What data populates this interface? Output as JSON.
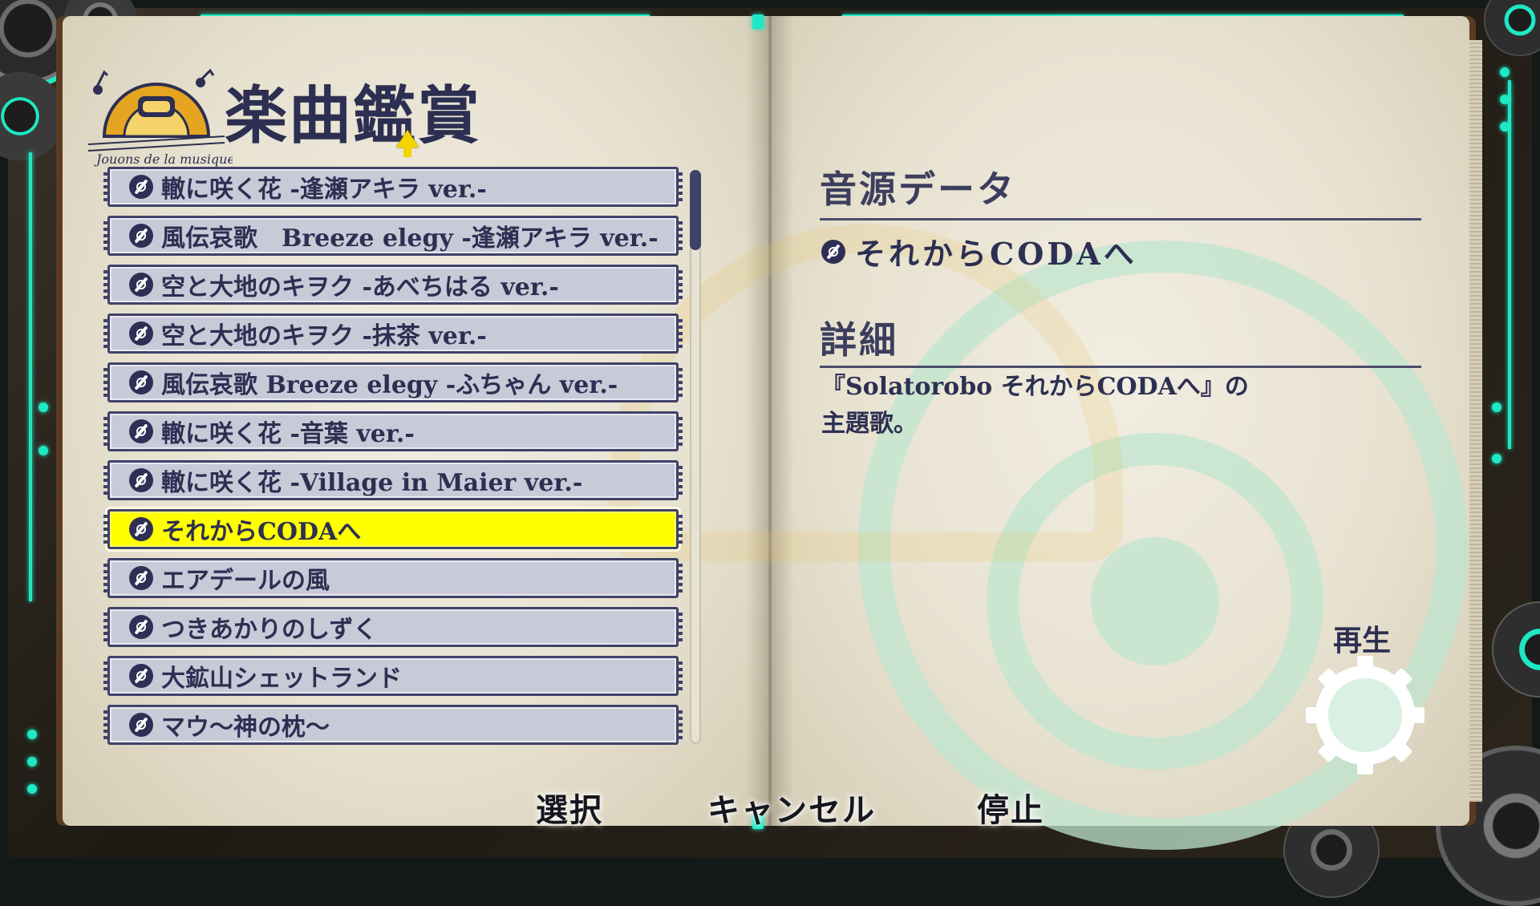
{
  "header": {
    "title": "楽曲鑑賞",
    "logo_text": "Jouons de la musique!"
  },
  "song_list": {
    "items": [
      {
        "label": "轍に咲く花 -逢瀬アキラ ver.-",
        "selected": false
      },
      {
        "label": "風伝哀歌　Breeze elegy -逢瀬アキラ ver.-",
        "selected": false
      },
      {
        "label": "空と大地のキヲク -あべちはる ver.-",
        "selected": false
      },
      {
        "label": "空と大地のキヲク -抹茶 ver.-",
        "selected": false
      },
      {
        "label": "風伝哀歌 Breeze elegy -ふちゃん ver.-",
        "selected": false
      },
      {
        "label": "轍に咲く花 -音葉 ver.-",
        "selected": false
      },
      {
        "label": "轍に咲く花 -Village in Maier ver.-",
        "selected": false
      },
      {
        "label": "それからCODAへ",
        "selected": true
      },
      {
        "label": "エアデールの風",
        "selected": false
      },
      {
        "label": "つきあかりのしずく",
        "selected": false
      },
      {
        "label": "大鉱山シェットランド",
        "selected": false
      },
      {
        "label": "マウ〜神の枕〜",
        "selected": false
      }
    ],
    "item_icon": "music-disc-icon"
  },
  "details": {
    "source_heading": "音源データ",
    "source_track": "それからCODAへ",
    "detail_heading": "詳細",
    "detail_line1": "『Solatorobo それからCODAへ』の",
    "detail_line2": "主題歌。"
  },
  "controls": {
    "play_label": "再生",
    "select_label": "選択",
    "cancel_label": "キャンセル",
    "stop_label": "停止"
  },
  "colors": {
    "accent_neon": "#1de9c4",
    "selection": "#ffff00",
    "ink": "#2d2f52",
    "list_item_bg": "#c9cad8",
    "watermark_green": "#bfe6cf",
    "watermark_gold": "#e9c45a"
  }
}
